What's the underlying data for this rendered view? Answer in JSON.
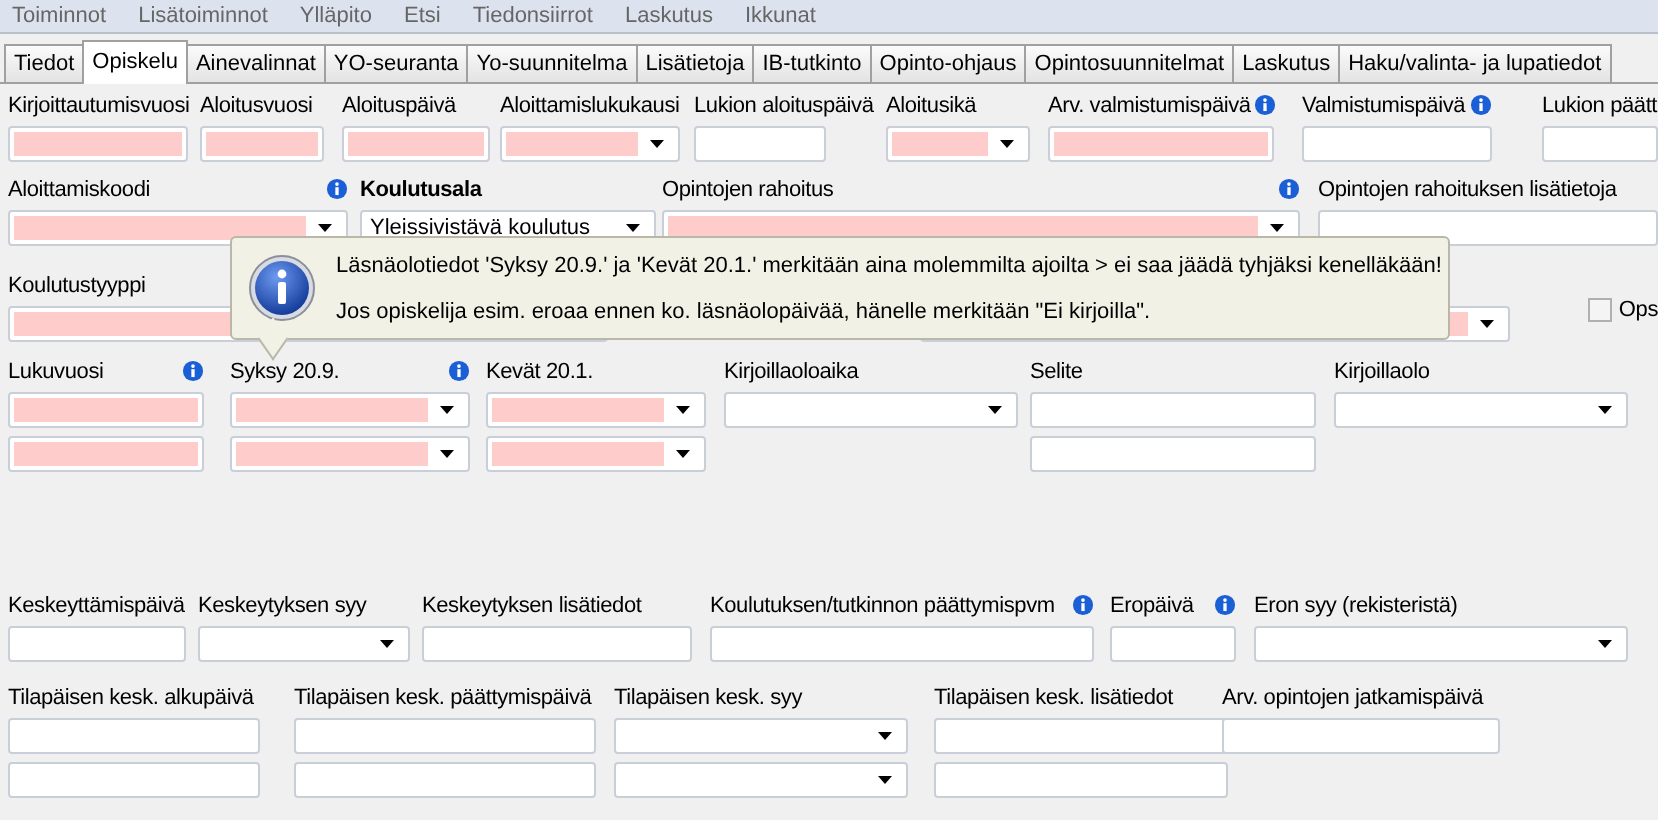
{
  "menu": [
    "Toiminnot",
    "Lisätoiminnot",
    "Ylläpito",
    "Etsi",
    "Tiedonsiirrot",
    "Laskutus",
    "Ikkunat"
  ],
  "tabs": [
    {
      "label": "Tiedot",
      "selected": false
    },
    {
      "label": "Opiskelu",
      "selected": true
    },
    {
      "label": "Ainevalinnat",
      "selected": false
    },
    {
      "label": "YO-seuranta",
      "selected": false
    },
    {
      "label": "Yo-suunnitelma",
      "selected": false
    },
    {
      "label": "Lisätietoja",
      "selected": false
    },
    {
      "label": "IB-tutkinto",
      "selected": false
    },
    {
      "label": "Opinto-ohjaus",
      "selected": false
    },
    {
      "label": "Opintosuunnitelmat",
      "selected": false
    },
    {
      "label": "Laskutus",
      "selected": false
    },
    {
      "label": "Haku/valinta- ja lupatiedot",
      "selected": false
    }
  ],
  "rows": [
    {
      "fields": [
        {
          "label": "Kirjoittautumisvuosi",
          "kind": "text",
          "required": true
        },
        {
          "label": "Aloitusvuosi",
          "kind": "text",
          "required": true
        },
        {
          "label": "Aloituspäivä",
          "kind": "text",
          "required": true
        },
        {
          "label": "Aloittamislukukausi",
          "kind": "select",
          "required": true
        },
        {
          "label": "Lukion aloituspäivä",
          "kind": "text",
          "required": false
        },
        {
          "label": "Aloitusikä",
          "kind": "select",
          "required": true
        },
        {
          "label": "Arv. valmistumispäivä",
          "kind": "text",
          "required": true,
          "info": true
        },
        {
          "label": "Valmistumispäivä",
          "kind": "text",
          "required": false,
          "info": true
        },
        {
          "label": "Lukion päätt",
          "kind": "text",
          "required": false
        }
      ]
    },
    {
      "fields": [
        {
          "label": "Aloittamiskoodi",
          "kind": "select",
          "required": true,
          "info": true
        },
        {
          "label": "Koulutusala",
          "bold": true,
          "kind": "select",
          "required": false,
          "value": "Yleissivistävä koulutus"
        },
        {
          "label": "Opintojen rahoitus",
          "kind": "select",
          "required": true,
          "info": true
        },
        {
          "label": "Opintojen rahoituksen lisätietoja",
          "kind": "text",
          "required": false
        }
      ]
    },
    {
      "fields": [
        {
          "label": "Koulutustyyppi",
          "kind": "text",
          "required": true
        },
        {
          "kind": "select",
          "required": true
        }
      ],
      "checkbox": {
        "label": "Ops",
        "checked": false
      }
    },
    {
      "fields": [
        {
          "label": "Lukuvuosi",
          "kind": "text_pair",
          "required": true,
          "info": true
        },
        {
          "label": "Syksy 20.9.",
          "kind": "select_pair",
          "required": true,
          "info": true
        },
        {
          "label": "Kevät 20.1.",
          "kind": "select_pair",
          "required": true
        },
        {
          "label": "Kirjoillaoloaika",
          "kind": "select",
          "required": false
        },
        {
          "label": "Selite",
          "kind": "text_pair",
          "required": false
        },
        {
          "label": "Kirjoillaolo",
          "kind": "select",
          "required": false
        }
      ]
    },
    {
      "fields": [
        {
          "label": "Keskeyttämispäivä",
          "kind": "text",
          "required": false
        },
        {
          "label": "Keskeytyksen syy",
          "kind": "select",
          "required": false
        },
        {
          "label": "Keskeytyksen lisätiedot",
          "kind": "text",
          "required": false
        },
        {
          "label": "Koulutuksen/tutkinnon päättymispvm",
          "kind": "text",
          "required": false,
          "info": true
        },
        {
          "label": "Eropäivä",
          "kind": "text",
          "required": false,
          "info": true
        },
        {
          "label": "Eron syy (rekisteristä)",
          "kind": "select",
          "required": false
        }
      ]
    },
    {
      "fields": [
        {
          "label": "Tilapäisen kesk. alkupäivä",
          "kind": "text_pair",
          "required": false
        },
        {
          "label": "Tilapäisen kesk. päättymispäivä",
          "kind": "text_pair",
          "required": false
        },
        {
          "label": "Tilapäisen kesk. syy",
          "kind": "select_pair",
          "required": false
        },
        {
          "label": "Tilapäisen kesk. lisätiedot",
          "kind": "text_pair",
          "required": false
        },
        {
          "label": "Arv. opintojen jatkamispäivä",
          "kind": "text",
          "required": false
        }
      ]
    }
  ],
  "tooltip": {
    "lines": [
      "Läsnäolotiedot 'Syksy 20.9.' ja 'Kevät 20.1.' merkitään aina molemmilta ajoilta > ei saa jäädä tyhjäksi kenelläkään!",
      "Jos opiskelija esim. eroaa ennen ko. läsnäolopäivää, hänelle merkitään \"Ei kirjoilla\"."
    ]
  }
}
